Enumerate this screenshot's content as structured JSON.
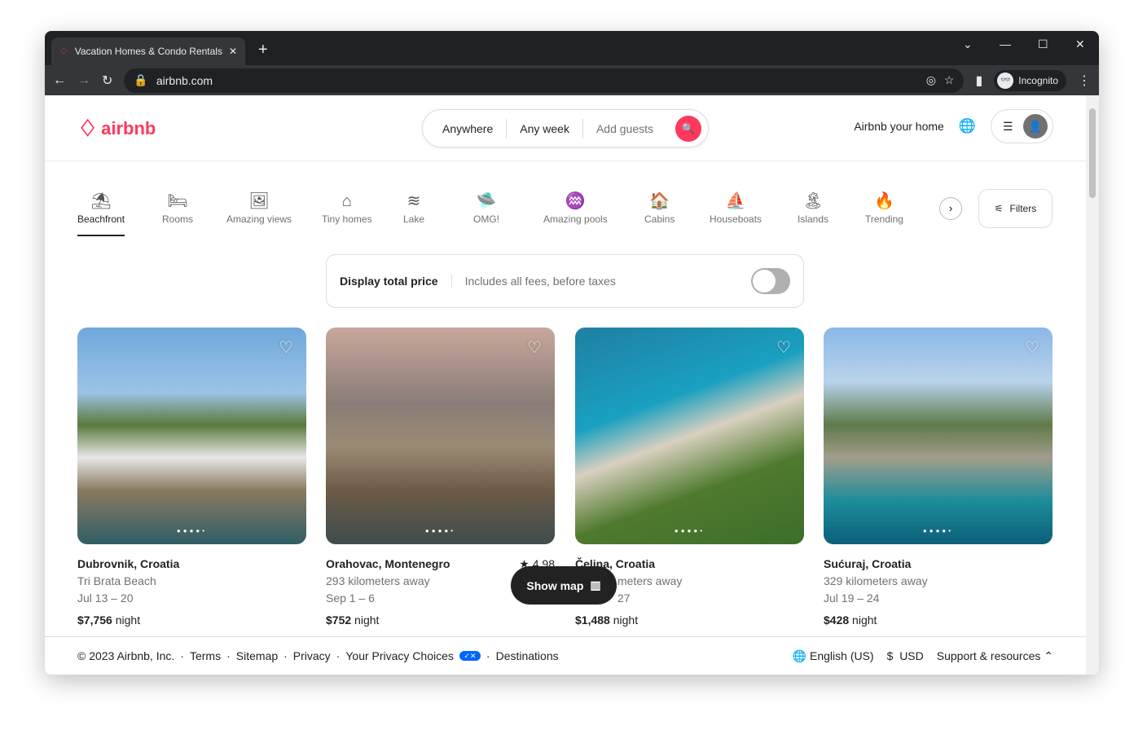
{
  "browser": {
    "tab_title": "Vacation Homes & Condo Rentals - Airbnb",
    "url": "airbnb.com",
    "profile": "Incognito"
  },
  "header": {
    "logo": "airbnb",
    "search": {
      "anywhere": "Anywhere",
      "any_week": "Any week",
      "guests": "Add guests"
    },
    "host": "Airbnb your home"
  },
  "categories": [
    {
      "label": "Beachfront",
      "icon": "beach-icon",
      "glyph": "⛱",
      "active": true
    },
    {
      "label": "Rooms",
      "icon": "bed-icon",
      "glyph": "🛏"
    },
    {
      "label": "Amazing views",
      "icon": "view-icon",
      "glyph": "🖼"
    },
    {
      "label": "Tiny homes",
      "icon": "tiny-home-icon",
      "glyph": "⌂"
    },
    {
      "label": "Lake",
      "icon": "lake-icon",
      "glyph": "≋"
    },
    {
      "label": "OMG!",
      "icon": "ufo-icon",
      "glyph": "🛸"
    },
    {
      "label": "Amazing pools",
      "icon": "pool-icon",
      "glyph": "♒"
    },
    {
      "label": "Cabins",
      "icon": "cabin-icon",
      "glyph": "🏠"
    },
    {
      "label": "Houseboats",
      "icon": "houseboat-icon",
      "glyph": "⛵"
    },
    {
      "label": "Islands",
      "icon": "island-icon",
      "glyph": "🏝"
    },
    {
      "label": "Trending",
      "icon": "flame-icon",
      "glyph": "🔥"
    }
  ],
  "filters": "Filters",
  "price_toggle": {
    "label": "Display total price",
    "sub": "Includes all fees, before taxes",
    "on": false
  },
  "listings": [
    {
      "title": "Dubrovnik, Croatia",
      "line2": "Tri Brata Beach",
      "dates": "Jul 13 – 20",
      "price": "$7,756",
      "unit": "night",
      "rating": ""
    },
    {
      "title": "Orahovac, Montenegro",
      "line2": "293 kilometers away",
      "dates": "Sep 1 – 6",
      "price": "$752",
      "unit": "night",
      "rating": "★ 4.98"
    },
    {
      "title": "Čelina, Croatia",
      "line2": "meters away",
      "dates": "27",
      "price": "$1,488",
      "unit": "night",
      "rating": ""
    },
    {
      "title": "Sućuraj, Croatia",
      "line2": "329 kilometers away",
      "dates": "Jul 19 – 24",
      "price": "$428",
      "unit": "night",
      "rating": ""
    }
  ],
  "show_map": "Show map",
  "footer": {
    "copyright": "© 2023 Airbnb, Inc.",
    "links": [
      "Terms",
      "Sitemap",
      "Privacy",
      "Your Privacy Choices",
      "Destinations"
    ],
    "language": "English (US)",
    "currency_symbol": "$",
    "currency": "USD",
    "support": "Support & resources"
  }
}
